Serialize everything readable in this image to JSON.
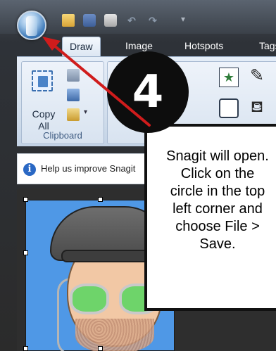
{
  "tabs": [
    {
      "label": "Draw"
    },
    {
      "label": "Image"
    },
    {
      "label": "Hotspots"
    },
    {
      "label": "Tags"
    }
  ],
  "ribbon": {
    "clipboard": {
      "copy_all_label_line1": "Copy",
      "copy_all_label_line2": "All",
      "group_label": "Clipboard"
    }
  },
  "infobar": {
    "text": "Help us improve Snagit"
  },
  "callout": {
    "lines": [
      "Snagit will open.",
      "Click on the",
      "circle in the top",
      "left corner and",
      "choose File >",
      "Save."
    ]
  },
  "step_badge": "4",
  "colors": {
    "annotation_arrow": "#d01c1c",
    "canvas_background": "#4f98e6",
    "glasses": "#6ed46a"
  },
  "icons": [
    "app-orb-icon",
    "folder-icon",
    "save-icon",
    "print-icon",
    "undo-icon",
    "redo-icon",
    "cut-icon",
    "copy-icon",
    "paste-icon",
    "star-stamp-icon",
    "pen-icon",
    "shape-icon",
    "fill-bucket-icon",
    "info-icon"
  ]
}
